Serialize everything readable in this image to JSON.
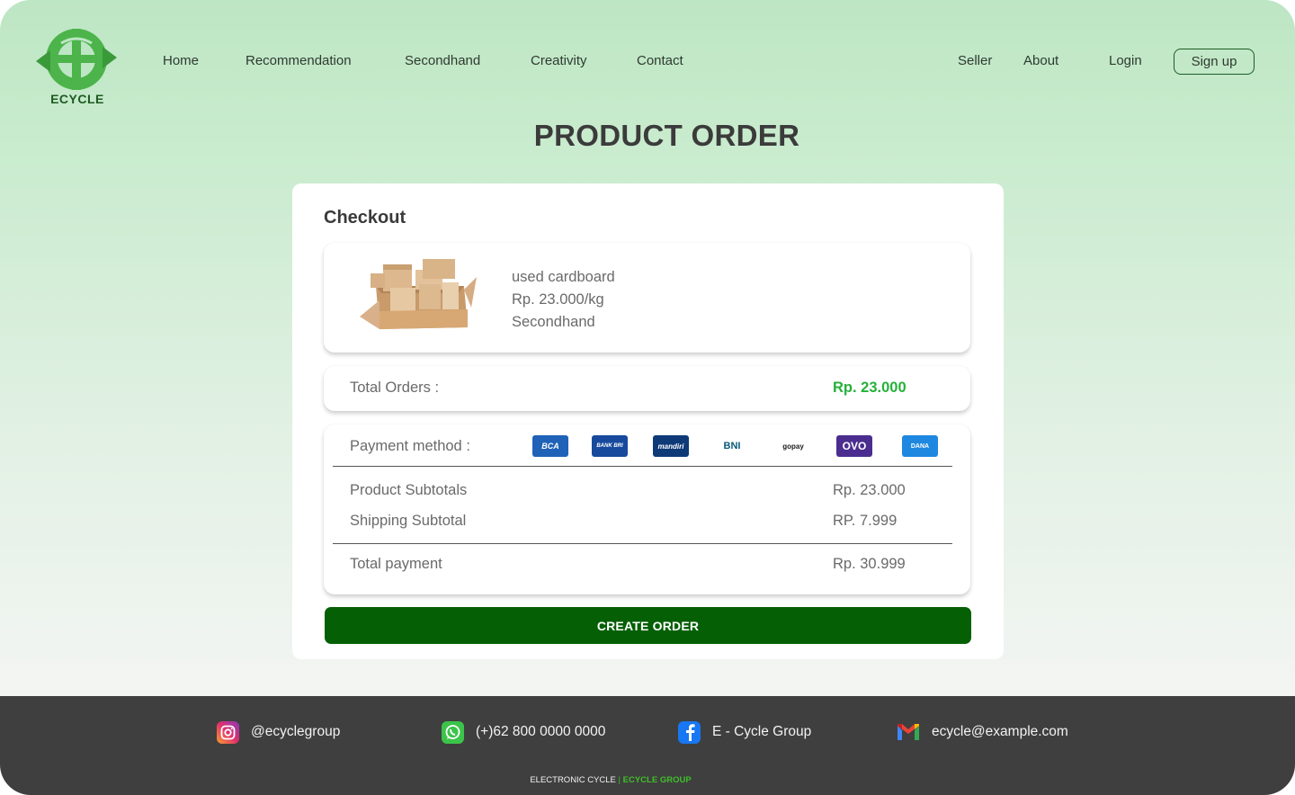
{
  "brand": {
    "name": "ECYCLE"
  },
  "nav": {
    "home": "Home",
    "recommendation": "Recommendation",
    "secondhand": "Secondhand",
    "creativity": "Creativity",
    "contact": "Contact",
    "seller": "Seller",
    "about": "About",
    "login": "Login",
    "signup": "Sign up"
  },
  "page_title": "PRODUCT ORDER",
  "checkout": {
    "title": "Checkout",
    "product": {
      "name": "used cardboard",
      "price": "Rp. 23.000/kg",
      "category": "Secondhand",
      "image_icon": "cardboard-boxes-image"
    },
    "total_orders_label": "Total Orders :",
    "total_orders_value": "Rp. 23.000",
    "payment_label": "Payment method :",
    "payment_methods": [
      "BCA",
      "BANK BRI",
      "mandiri",
      "BNI",
      "gopay",
      "OVO",
      "DANA"
    ],
    "product_subtotal_label": "Product Subtotals",
    "product_subtotal_value": "Rp. 23.000",
    "shipping_label": "Shipping Subtotal",
    "shipping_value": "RP. 7.999",
    "total_payment_label": "Total payment",
    "total_payment_value": "Rp. 30.999",
    "create_button": "CREATE ORDER"
  },
  "footer": {
    "instagram": "@ecyclegroup",
    "whatsapp": "(+)62 800 0000 0000",
    "facebook": "E - Cycle Group",
    "email": "ecycle@example.com",
    "copyright_main": "ELECTRONIC CYCLE",
    "copyright_sep": " | ",
    "copyright_accent": "ECYCLE GROUP"
  },
  "colors": {
    "brand_green": "#4cb44a",
    "dark_green_button": "#056005",
    "total_green": "#26b03a",
    "footer_bg": "#3f3f3f"
  }
}
